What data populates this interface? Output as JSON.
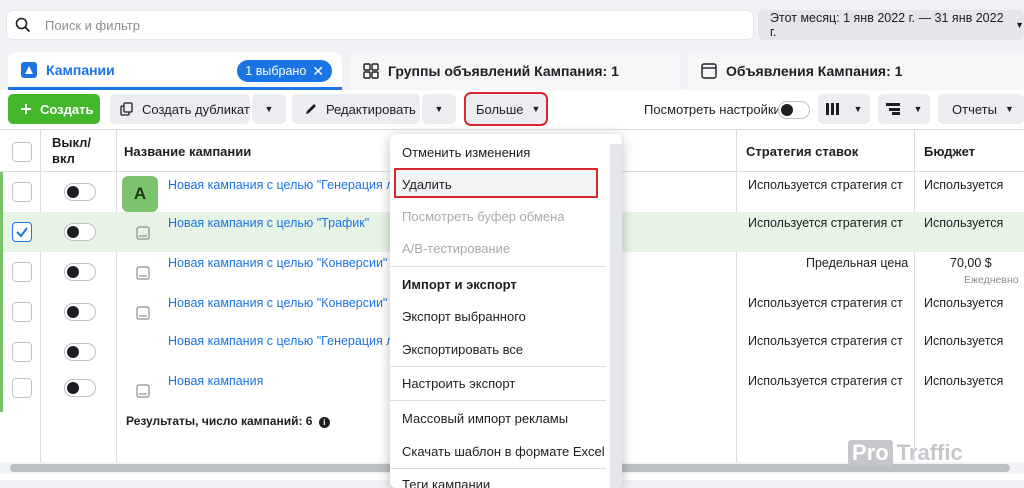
{
  "search": {
    "placeholder": "Поиск и фильтр"
  },
  "date_range": "Этот месяц: 1 янв 2022 г. — 31 янв 2022 г.",
  "tabs": [
    {
      "label": "Кампании",
      "badge": "1 выбрано"
    },
    {
      "label": "Группы объявлений Кампания: 1"
    },
    {
      "label": "Объявления Кампания: 1"
    }
  ],
  "toolbar": {
    "create": "Создать",
    "duplicate": "Создать дубликат",
    "edit": "Редактировать",
    "more": "Больше",
    "view_settings": "Посмотреть настройки",
    "reports": "Отчеты"
  },
  "table": {
    "headers": {
      "toggle": "Выкл/вкл",
      "name": "Название кампании",
      "strategy": "Стратегия ставок",
      "budget": "Бюджет"
    },
    "rows": [
      {
        "name": "Новая кампания с целью \"Генерация лид",
        "strategy": "Используется стратегия ст",
        "budget": "Используется",
        "checked": false,
        "avatar": "A"
      },
      {
        "name": "Новая кампания с целью \"Трафик\"",
        "strategy": "Используется стратегия ст",
        "budget": "Используется",
        "checked": true
      },
      {
        "name": "Новая кампания с целью \"Конверсии\"",
        "strategy": "Предельная цена",
        "budget": "70,00 $",
        "budget_sub": "Ежедневно",
        "checked": false
      },
      {
        "name": "Новая кампания с целью \"Конверсии\"",
        "strategy": "Используется стратегия ст",
        "budget": "Используется",
        "checked": false
      },
      {
        "name": "Новая кампания с целью \"Генерация лид",
        "strategy": "Используется стратегия ст",
        "budget": "Используется",
        "checked": false
      },
      {
        "name": "Новая кампания",
        "strategy": "Используется стратегия ст",
        "budget": "Используется",
        "checked": false
      }
    ],
    "totals": "Результаты, число кампаний: 6"
  },
  "dropdown": {
    "items": [
      {
        "label": "Отменить изменения"
      },
      {
        "label": "Удалить"
      },
      {
        "label": "Посмотреть буфер обмена"
      },
      {
        "label": "A/B-тестирование"
      },
      {
        "label": "Импорт и экспорт"
      },
      {
        "label": "Экспорт выбранного"
      },
      {
        "label": "Экспортировать все"
      },
      {
        "label": "Настроить экспорт"
      },
      {
        "label": "Массовый импорт рекламы"
      },
      {
        "label": "Скачать шаблон в формате Excel"
      },
      {
        "label": "Теги кампании"
      }
    ]
  },
  "watermark": {
    "pro": "Pro",
    "traffic": "Traffic"
  },
  "colors": {
    "accent": "#1b74e4",
    "create": "#42b72a",
    "highlight": "#d7282f"
  }
}
